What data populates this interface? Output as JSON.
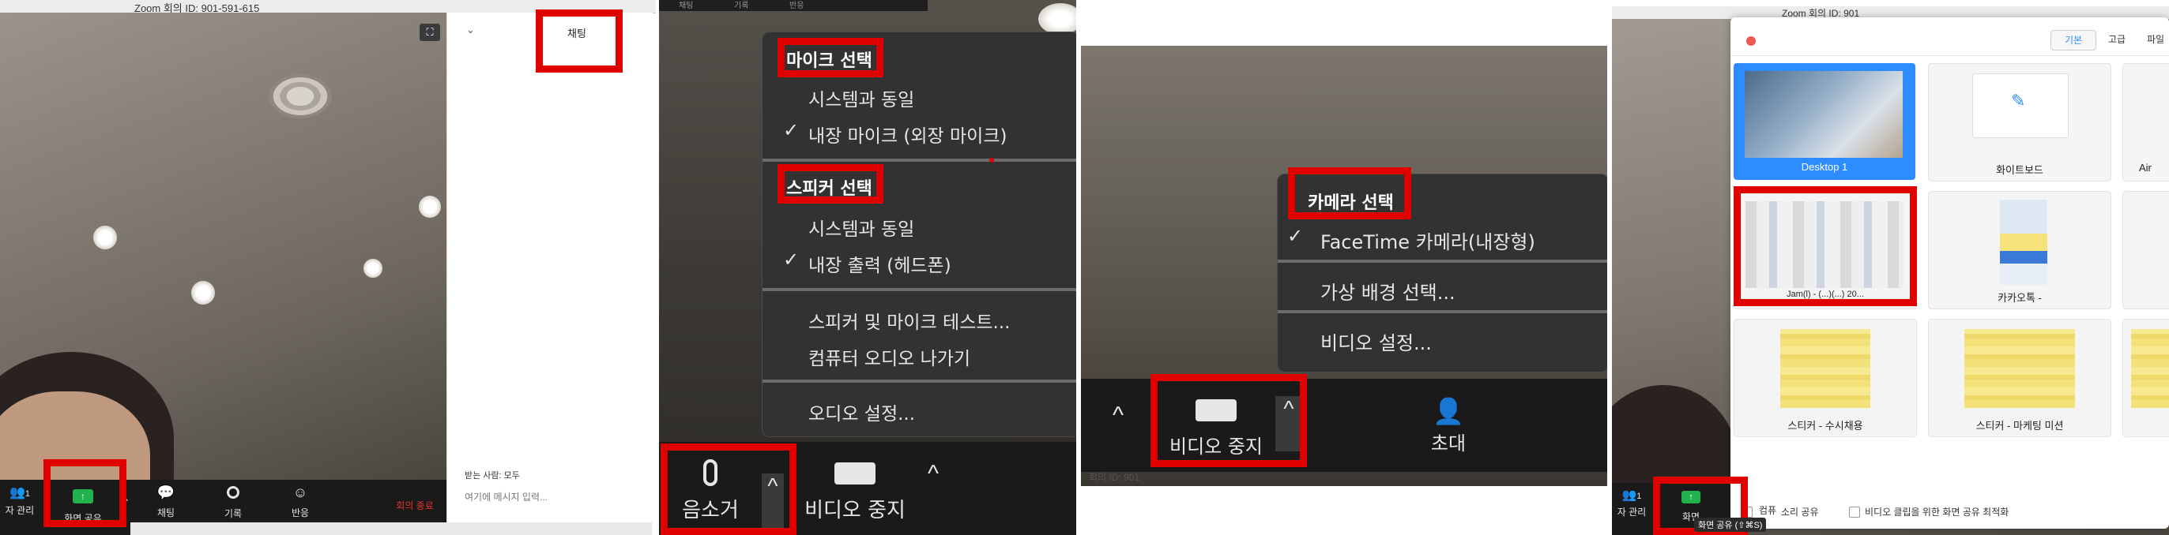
{
  "panel1": {
    "window_title": "Zoom 회의 ID: 901-591-615",
    "chat_tab_label": "채팅",
    "receiver_label": "받는 사람: 모두",
    "message_placeholder": "여기에 메시지 입력...",
    "toolbar": {
      "participants_count": "1",
      "participants_label": "자 관리",
      "share_screen_label": "화면 공유",
      "chat_label": "채팅",
      "record_label": "기록",
      "reactions_label": "반응",
      "end_meeting_label": "회의 종료"
    }
  },
  "panel2": {
    "top_tabs": [
      "채팅",
      "기록",
      "반응"
    ],
    "menu": {
      "mic_header": "마이크 선택",
      "mic_items": [
        "시스템과 동일",
        "내장 마이크 (외장 마이크)"
      ],
      "speaker_header": "스피커 선택",
      "speaker_items": [
        "시스템과 동일",
        "내장 출력 (헤드폰)"
      ],
      "test_item": "스피커 및 마이크 테스트...",
      "leave_audio_item": "컴퓨터 오디오 나가기",
      "audio_settings_item": "오디오 설정..."
    },
    "toolbar": {
      "mute_label": "음소거",
      "stop_video_label": "비디오 중지"
    }
  },
  "panel3": {
    "menu": {
      "camera_header": "카메라 선택",
      "camera_item": "FaceTime 카메라(내장형)",
      "virtual_bg_item": "가상 배경 선택...",
      "video_settings_item": "비디오 설정..."
    },
    "toolbar": {
      "stop_video_label": "비디오 중지",
      "invite_label": "초대"
    },
    "meeting_id_fragment": "회의 ID: 901"
  },
  "panel4": {
    "window_title": "Zoom 회의 ID: 901",
    "tabs": [
      "기본",
      "고급",
      "파일"
    ],
    "tiles": [
      {
        "label": "Desktop 1"
      },
      {
        "label": "화이트보드"
      },
      {
        "label": "Air"
      },
      {
        "label": "Jam(l) - (...)(...) 20..."
      },
      {
        "label": "카카오톡 -"
      },
      {
        "label": ""
      },
      {
        "label": "스티커 - 수시채용"
      },
      {
        "label": "스티커 - 마케팅 미션"
      },
      {
        "label": ""
      }
    ],
    "share_sound_label": "소리 공유",
    "optimize_label": "비디오 클립을 위한 화면 공유 최적화",
    "tooltip": "화면 공유 (⇧⌘S)",
    "toolbar": {
      "participants_count": "1",
      "participants_label": "자 관리",
      "share_screen_label": "화면",
      "share_fragment": "컴퓨"
    }
  },
  "colors": {
    "highlight_red": "#e00000",
    "share_green": "#21b14d",
    "end_meeting_red": "#e5322d",
    "selected_blue": "#2d8cff",
    "toolbar_dark": "#1a1a1a",
    "menu_dark": "#323232"
  }
}
